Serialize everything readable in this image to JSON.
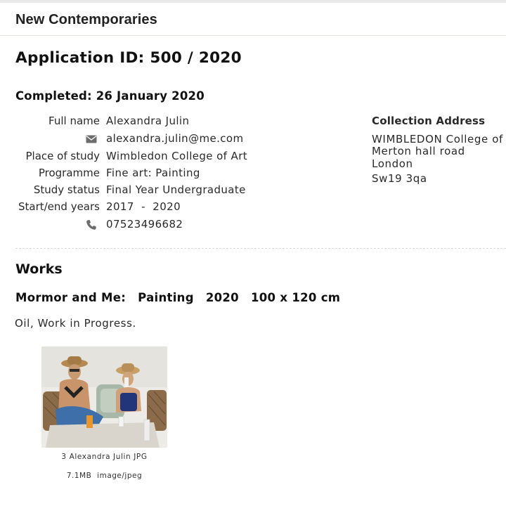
{
  "header": {
    "title": "New Contemporaries"
  },
  "application": {
    "id_label": "Application ID: 500 / 2020",
    "completed": "Completed: 26 January 2020"
  },
  "applicant": {
    "full_name_label": "Full name",
    "full_name": "Alexandra Julin",
    "email_icon": "envelope-icon",
    "email": "alexandra.julin@me.com",
    "place_of_study_label": "Place of study",
    "place_of_study": "Wimbledon College of Art",
    "programme_label": "Programme",
    "programme": "Fine art: Painting",
    "study_status_label": "Study status",
    "study_status": "Final Year Undergraduate",
    "start_end_label": "Start/end years",
    "start_end": "2017  -  2020",
    "phone_icon": "phone-icon",
    "phone": "07523496682"
  },
  "collection_address": {
    "title": "Collection Address",
    "line1": "WIMBLEDON College of",
    "line2": "Merton hall road",
    "line3": "London",
    "line4": "Sw19 3qa"
  },
  "works": {
    "section_title": "Works",
    "items": [
      {
        "title": "Mormor and Me:",
        "medium": "Painting",
        "year": "2020",
        "size": "100 x 120 cm",
        "description": "Oil, Work in Progress.",
        "file_name": "3 Alexandra Julin JPG",
        "file_size": "7.1MB",
        "file_type": "image/jpeg"
      }
    ]
  }
}
